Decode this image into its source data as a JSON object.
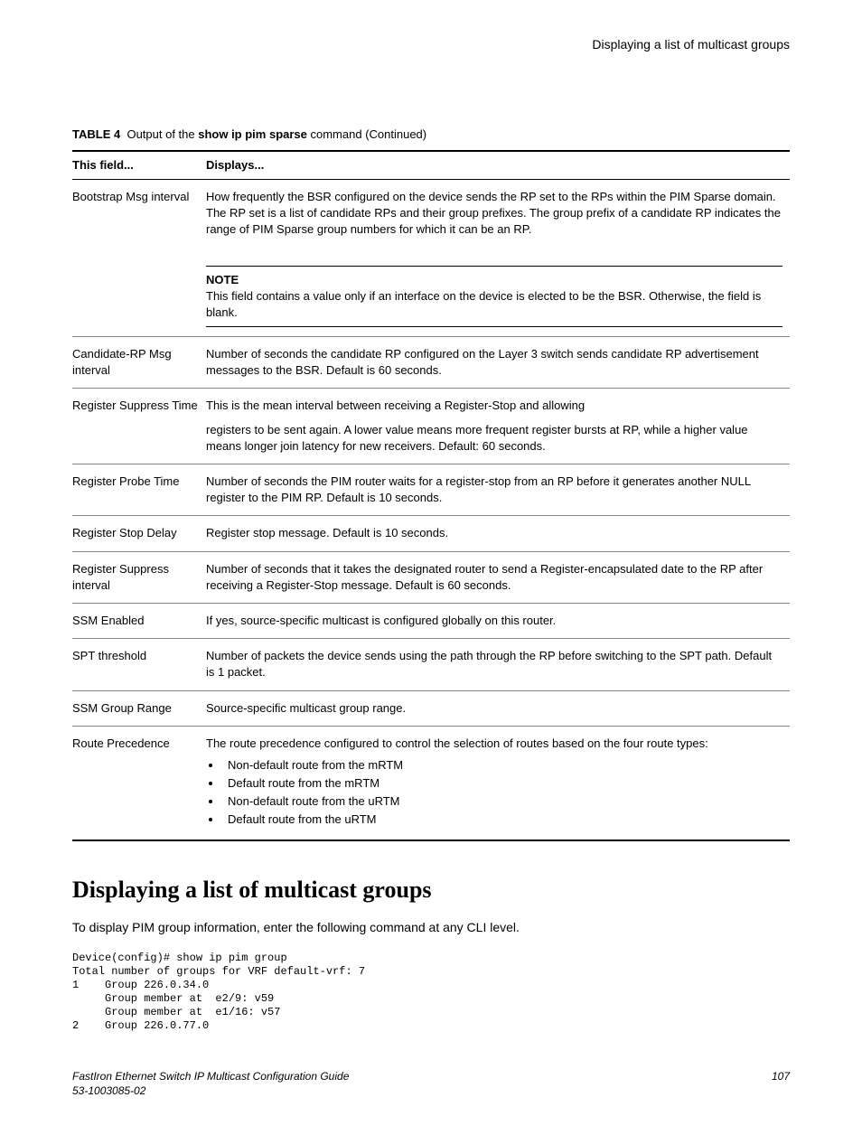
{
  "header": {
    "title": "Displaying a list of multicast groups"
  },
  "table": {
    "caption_prefix": "TABLE 4",
    "caption_mid": "Output of the ",
    "caption_bold": "show ip pim sparse",
    "caption_suffix": " command (Continued)",
    "col1": "This field...",
    "col2": "Displays...",
    "rows": [
      {
        "field": "Bootstrap Msg interval",
        "desc": "How frequently the BSR configured on the device sends the RP set to the RPs within the PIM Sparse domain. The RP set is a list of candidate RPs and their group prefixes. The group prefix of a candidate RP indicates the range of PIM Sparse group numbers for which it can be an RP.",
        "note_title": "NOTE",
        "note_body": "This field contains a value only if an interface on the device is elected to be the BSR. Otherwise, the field is blank."
      },
      {
        "field": "Candidate-RP Msg interval",
        "desc": "Number of seconds the candidate RP configured on the Layer 3 switch sends candidate RP advertisement messages to the BSR. Default is 60 seconds."
      },
      {
        "field": "Register Suppress Time",
        "desc": "This is the mean interval between receiving a Register-Stop and allowing",
        "desc2": "registers to be sent again. A lower value means more frequent register bursts at RP, while a higher value means longer join latency for new receivers. Default: 60 seconds."
      },
      {
        "field": "Register Probe Time",
        "desc": "Number of seconds the PIM router waits for a register-stop from an RP before it generates another NULL register to the PIM RP. Default is 10 seconds."
      },
      {
        "field": "Register Stop Delay",
        "desc": "Register stop message. Default is 10 seconds."
      },
      {
        "field": "Register Suppress interval",
        "desc": "Number of seconds that it takes the designated router to send a Register-encapsulated date to the RP after receiving a Register-Stop message. Default is 60 seconds."
      },
      {
        "field": "SSM Enabled",
        "desc": "If yes, source-specific multicast is configured globally on this router."
      },
      {
        "field": "SPT threshold",
        "desc": "Number of packets the device sends using the path through the RP before switching to the SPT path. Default is 1 packet."
      },
      {
        "field": "SSM Group Range",
        "desc": "Source-specific multicast group range."
      },
      {
        "field": "Route Precedence",
        "desc": "The route precedence configured to control the selection of routes based on the four route types:",
        "bullets": [
          "Non-default route from the mRTM",
          "Default route from the mRTM",
          "Non-default route from the uRTM",
          "Default route from the uRTM"
        ]
      }
    ]
  },
  "section": {
    "heading": "Displaying a list of multicast groups",
    "intro": "To display PIM group information, enter the following command at any CLI level.",
    "cli": "Device(config)# show ip pim group\nTotal number of groups for VRF default-vrf: 7\n1    Group 226.0.34.0\n     Group member at  e2/9: v59\n     Group member at  e1/16: v57\n2    Group 226.0.77.0"
  },
  "footer": {
    "left1": "FastIron Ethernet Switch IP Multicast Configuration Guide",
    "left2": "53-1003085-02",
    "right": "107"
  }
}
